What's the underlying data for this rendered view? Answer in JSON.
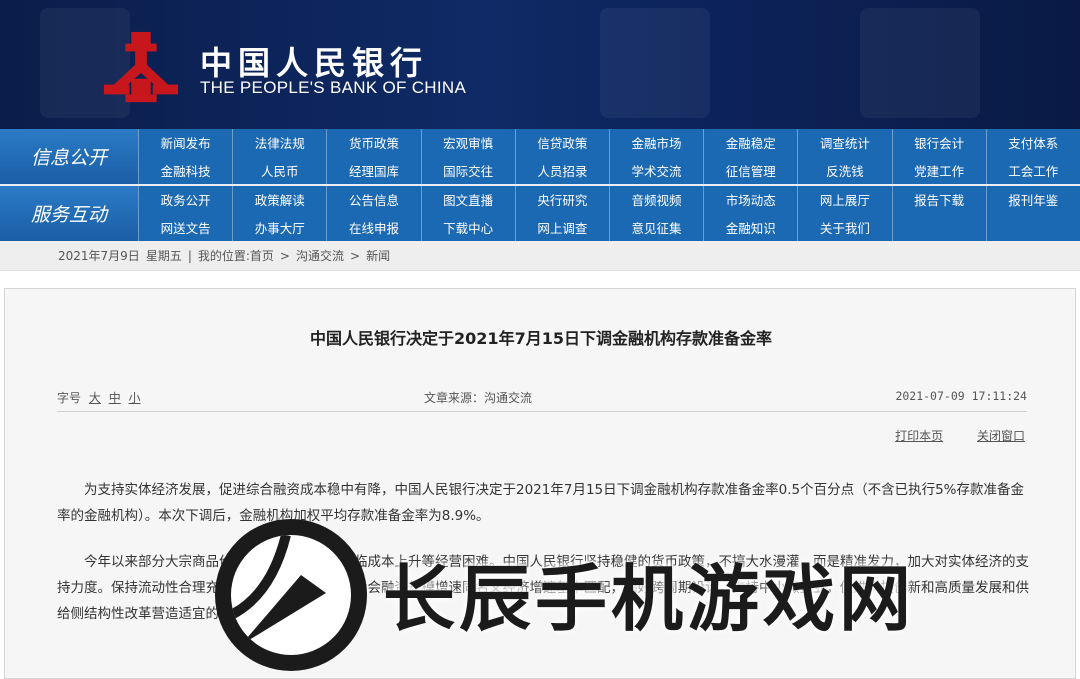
{
  "header": {
    "logo_cn": "中国人民银行",
    "logo_en": "THE PEOPLE'S BANK OF CHINA",
    "brand_color": "#c8161d",
    "banner_color": "#0f2a66"
  },
  "nav": {
    "sections": [
      {
        "label": "信息公开",
        "items": [
          "新闻发布",
          "法律法规",
          "货币政策",
          "宏观审慎",
          "信贷政策",
          "金融市场",
          "金融稳定",
          "调查统计",
          "银行会计",
          "支付体系",
          "金融科技",
          "人民币",
          "经理国库",
          "国际交往",
          "人员招录",
          "学术交流",
          "征信管理",
          "反洗钱",
          "党建工作",
          "工会工作"
        ]
      },
      {
        "label": "服务互动",
        "items": [
          "政务公开",
          "政策解读",
          "公告信息",
          "图文直播",
          "央行研究",
          "音频视频",
          "市场动态",
          "网上展厅",
          "报告下载",
          "报刊年鉴",
          "网送文告",
          "办事大厅",
          "在线申报",
          "下载中心",
          "网上调查",
          "意见征集",
          "金融知识",
          "关于我们",
          "",
          ""
        ]
      }
    ]
  },
  "breadcrumb": {
    "date": "2021年7月9日",
    "weekday": "星期五",
    "sep": "|",
    "location_label": "我的位置:首页",
    "arrow": ">",
    "level2": "沟通交流",
    "level3": "新闻"
  },
  "article": {
    "title": "中国人民银行决定于2021年7月15日下调金融机构存款准备金率",
    "font_size_label": "字号",
    "font_sizes": [
      "大",
      "中",
      "小"
    ],
    "source": "文章来源：沟通交流",
    "datetime": "2021-07-09 17:11:24",
    "print_label": "打印本页",
    "close_label": "关闭窗口",
    "paragraphs": [
      "为支持实体经济发展，促进综合融资成本稳中有降，中国人民银行决定于2021年7月15日下调金融机构存款准备金率0.5个百分点（不含已执行5%存款准备金率的金融机构）。本次下调后，金融机构加权平均存款准备金率为8.9%。",
      "今年以来部分大宗商品价格上涨，一些企业面临成本上升等经营困难。中国人民银行坚持稳健的货币政策，不搞大水漫灌，而是精准发力，加大对实体经济的支持力度。保持流动性合理充裕，保持货币供应量和社会融资规模增速同名义经济增速基本匹配，搞好跨周期设计，支持中小微企业，促进科技创新和高质量发展和供给侧结构性改革营造适宜的货币金融环境。（完）"
    ]
  },
  "watermark": {
    "text": "长辰手机游戏网"
  }
}
